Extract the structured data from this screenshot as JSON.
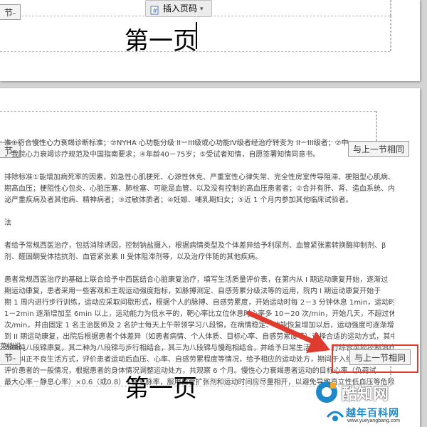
{
  "toolbar": {
    "insert_page_number_label": "插入页码",
    "chevron": "▾"
  },
  "page_top": {
    "header_tag": "节-",
    "heading": "第一页"
  },
  "page_bottom": {
    "header_tag": "节-",
    "footer_tag": "节-",
    "same_as_previous_header": "与上一节相同",
    "same_as_previous_footer": "与上一节相同",
    "footer_text": "第一页",
    "body_lines": [
      "准①符合慢性心力衰竭诊断标准；②NYHA 心功能分级 II－III级或心功能IV级者经治疗转变为 II－III级者；②中",
      "，我院心力衰竭诊疗规范及中国指南要求；④年龄40－75岁；⑤受试者知情，自愿签署知情同意书。",
      "",
      "排除标准①能增加病死率的因素，如急性心肌梗死、心源性休克、严重室性心律失常、完全性房室传导阻滞、梗阻型心肌病、未",
      "期高血压；梗阻性心包炎、心脏压塞、肺栓塞、可能是血管、以及没有控制的高血压患者者；②合并有肝、肾、造血系统、内分",
      "泌严重疾病及者其他病、精神病者；③过敏体质者；④妊娠、哺乳期妇女；⑤近 1 个月内参加其他临床试验者。",
      "",
      "法",
      "",
      "者给予常规西医治疗，包括消除诱因，控制钠盐摄入，根据病情类型及个体差异给予利尿剂、血管紧张素转换酶抑制剂、β",
      "剂、醛固酮受体拮抗剂、血管紧张素 II 受体阻滞剂等，以及治疗伴随的其他疾病。",
      "",
      "患者常规西医治疗的基础上联合给予中西医结合心脏康复治疗，填写生活质量评价表，在第内从 I 期运动康复开始，逐渐过",
      "期运动康复，患者采用一些客观和主观运动强度指标，如脉搏测定、自感劳累分级法等的运用，院内 I 期运动康复开始于",
      "期 1 周内进行步行训练，运动应采取间歇形式，根据个人的脉搏、自感劳累度，开始运动时每 2－3 分钟休息 1min，运动时",
      "1－2min 逐渐增加至 6min 以上，运动能力为低水平的，靶心率比立位休息时心率多 10－20 次/min，开始几天，不超过休息心率",
      "次/min，并由固定 1 名主治医师及 2 名护士每天上午带领学习八段锦，在病情稳定、功能恢复增加以后，运动强度可逐渐增加，",
      "到 II 期运动康复，出院后根据患者个体差异（如患者病情、个人体质、目标心率、自感劳累度等）选择合适的运动方式，其中",
      "为单纯八段锦康复，其二种为八段锦与步行相结合，其三为八段锦与慢跑相结合，并给予日常生活指导，行综合风险控制治疗",
      "伤，纠正不良生活方式，评价患者运动后血压、心率、自感劳累程度等情况，给予相应的运动处方，期间于入组后 2 周及 1、2",
      "评价患者的一般情况，根据患者的身体情况调整运动处方，共观察 6 个月。慢性心力衰竭患者运动的目标心率（负荷试",
      "最大心率－静息心率）×0.6（或0.8）+静息脉率，服用血管扩张剂和运动时间应尽量相开，以避免导致直立性低血压等危险。"
    ],
    "body_fragment_bottom": "莱拨说"
  },
  "watermark": {
    "brand": "酷知网",
    "site_name": "越年百科网",
    "site_url": "www.yueyangbang.com"
  },
  "colors": {
    "annotation_red": "#e03b2f",
    "gray_background": "#d4d4d4",
    "watermark_blue": "#1e88c8"
  }
}
